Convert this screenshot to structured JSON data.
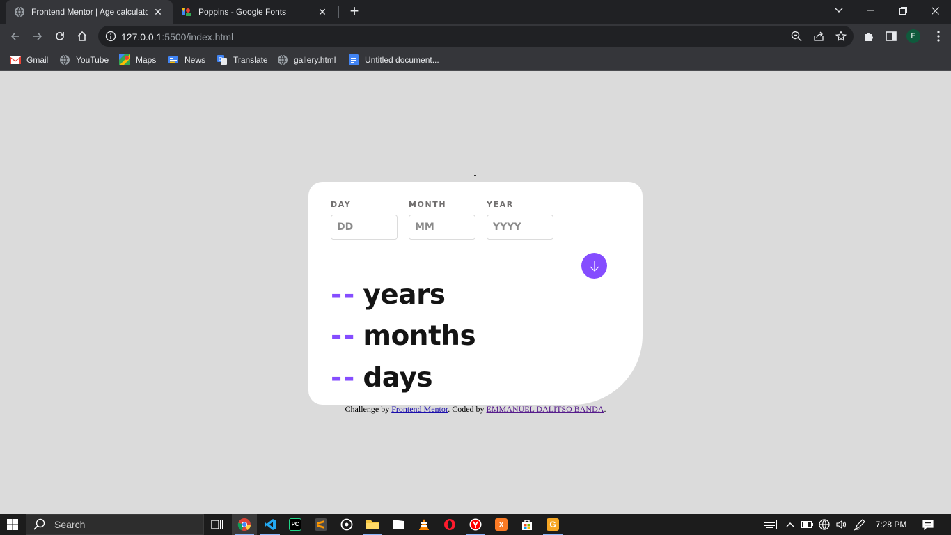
{
  "browser": {
    "tabs": [
      {
        "title": "Frontend Mentor | Age calculator",
        "active": true
      },
      {
        "title": "Poppins - Google Fonts",
        "active": false
      }
    ],
    "url_host": "127.0.0.1",
    "url_path": ":5500/index.html",
    "profile_initial": "E",
    "bookmarks": [
      "Gmail",
      "YouTube",
      "Maps",
      "News",
      "Translate",
      "gallery.html",
      "Untitled document..."
    ]
  },
  "form": {
    "day_label": "DAY",
    "month_label": "MONTH",
    "year_label": "YEAR",
    "day_placeholder": "DD",
    "month_placeholder": "MM",
    "year_placeholder": "YYYY"
  },
  "results": {
    "years_value": "--",
    "years_unit": "years",
    "months_value": "--",
    "months_unit": "months",
    "days_value": "--",
    "days_unit": "days"
  },
  "footer": {
    "prefix": "Challenge by ",
    "link1": "Frontend Mentor",
    "middle": ". Coded by ",
    "link2": "EMMANUEL DALITSO BANDA",
    "suffix": "."
  },
  "taskbar": {
    "search_text": "Search",
    "time": "7:28 PM"
  },
  "colors": {
    "accent": "#854dff",
    "page_bg": "#dbdbdb",
    "ink": "#141414"
  }
}
